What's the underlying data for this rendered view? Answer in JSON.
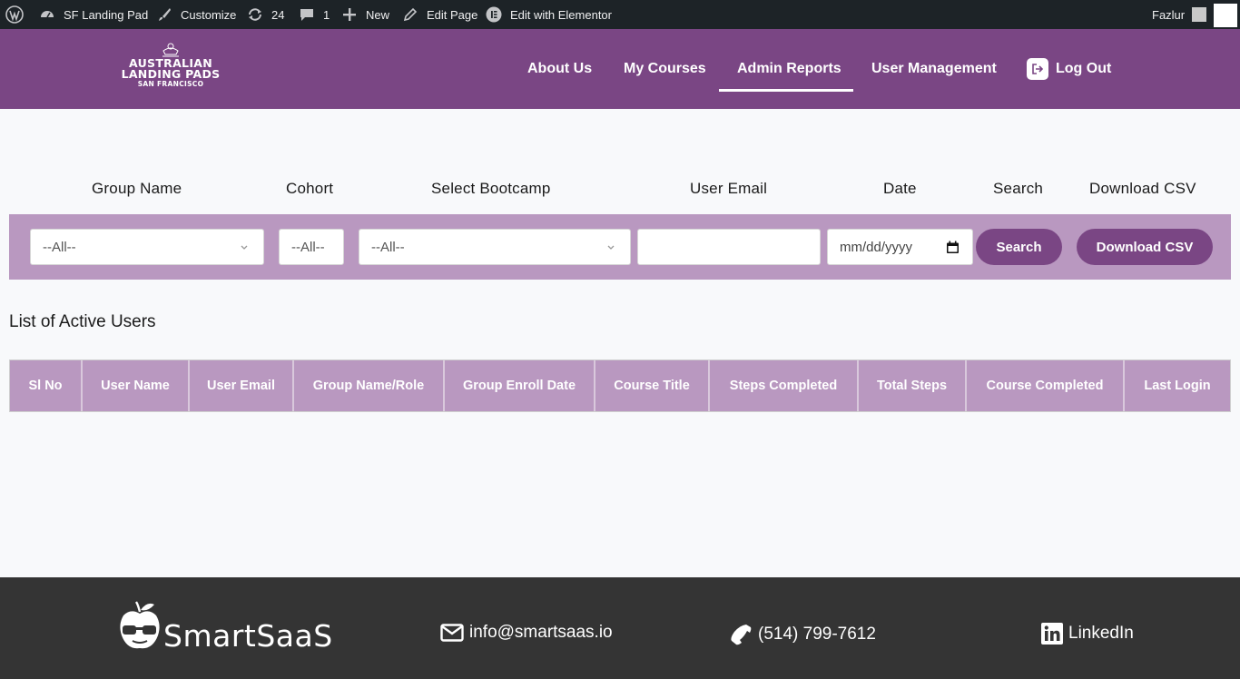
{
  "admin_bar": {
    "site_name": "SF Landing Pad",
    "customize": "Customize",
    "updates_count": "24",
    "comments_count": "1",
    "new_label": "New",
    "edit_page": "Edit Page",
    "elementor": "Edit with Elementor",
    "user_name": "Fazlur"
  },
  "header": {
    "logo": {
      "line1": "AUSTRALIAN",
      "line2": "LANDING PADS",
      "line3": "SAN FRANCISCO"
    },
    "nav": [
      {
        "label": "About Us"
      },
      {
        "label": "My Courses"
      },
      {
        "label": "Admin Reports",
        "active": true
      },
      {
        "label": "User Management"
      },
      {
        "label": "Log Out",
        "icon": "logout-icon"
      }
    ]
  },
  "filters": {
    "labels": {
      "group_name": "Group Name",
      "cohort": "Cohort",
      "bootcamp": "Select Bootcamp",
      "user_email": "User Email",
      "date": "Date",
      "search": "Search",
      "download": "Download CSV"
    },
    "group_name_value": "--All--",
    "cohort_value": "--All--",
    "bootcamp_value": "--All--",
    "user_email_value": "",
    "date_placeholder": "mm/dd/yyyy",
    "search_button": "Search",
    "download_button": "Download CSV"
  },
  "list": {
    "title": "List of Active Users",
    "columns": [
      "Sl No",
      "User Name",
      "User Email",
      "Group Name/Role",
      "Group Enroll Date",
      "Course Title",
      "Steps Completed",
      "Total Steps",
      "Course Completed",
      "Last Login"
    ],
    "rows": []
  },
  "footer": {
    "brand": "SmartSaaS",
    "email": "info@smartsaas.io",
    "phone": "(514) 799-7612",
    "linkedin": "LinkedIn"
  },
  "colors": {
    "primary": "#7a4684",
    "filter_bg": "#b998c0",
    "admin_bar": "#1d2327",
    "footer_bg": "#343434"
  }
}
